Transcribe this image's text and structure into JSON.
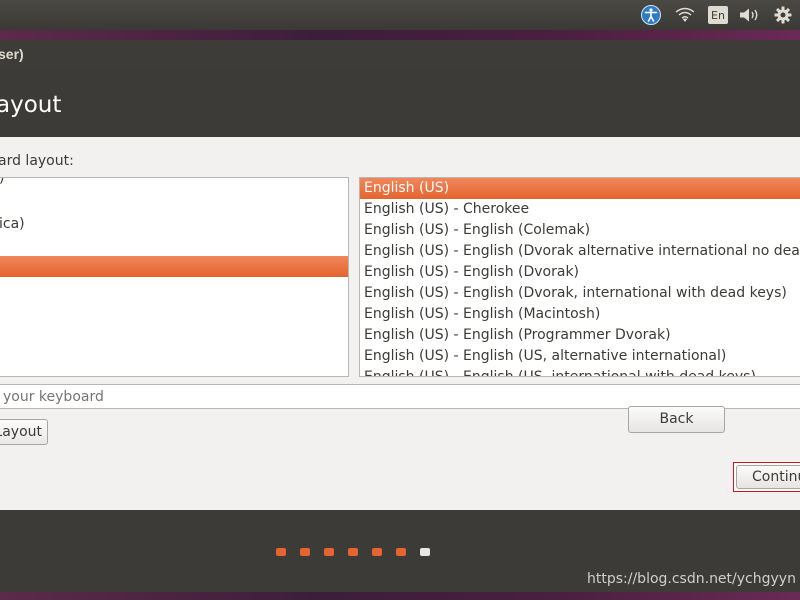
{
  "panel": {
    "keyboard_indicator": "En",
    "icons": [
      "accessibility-icon",
      "wifi-icon",
      "keyboard-indicator",
      "volume-icon",
      "settings-icon"
    ]
  },
  "window": {
    "title": "ser)",
    "heading": "ayout"
  },
  "content": {
    "layout_label": "ard layout:",
    "layouts": [
      ")",
      "",
      "ica)",
      "",
      "",
      "",
      "",
      "",
      ""
    ],
    "selected_layout_index": 4,
    "variants": [
      "English (US)",
      "English (US) - Cherokee",
      "English (US) - English (Colemak)",
      "English (US) - English (Dvorak alternative international no dead k",
      "English (US) - English (Dvorak)",
      "English (US) - English (Dvorak, international with dead keys)",
      "English (US) - English (Macintosh)",
      "English (US) - English (Programmer Dvorak)",
      "English (US) - English (US, alternative international)",
      "English (US) - English (US, international with dead keys)"
    ],
    "selected_variant_index": 0,
    "test_placeholder": "your keyboard",
    "detect_label": "Layout"
  },
  "buttons": {
    "back": "Back",
    "continue": "Continue"
  },
  "progress": {
    "total_steps": 7,
    "current_step": 7
  },
  "watermark": "https://blog.csdn.net/ychgyyn",
  "colors": {
    "accent": "#e5642f",
    "highlight_box": "#d0141e",
    "dark_chrome": "#3c3b37"
  }
}
